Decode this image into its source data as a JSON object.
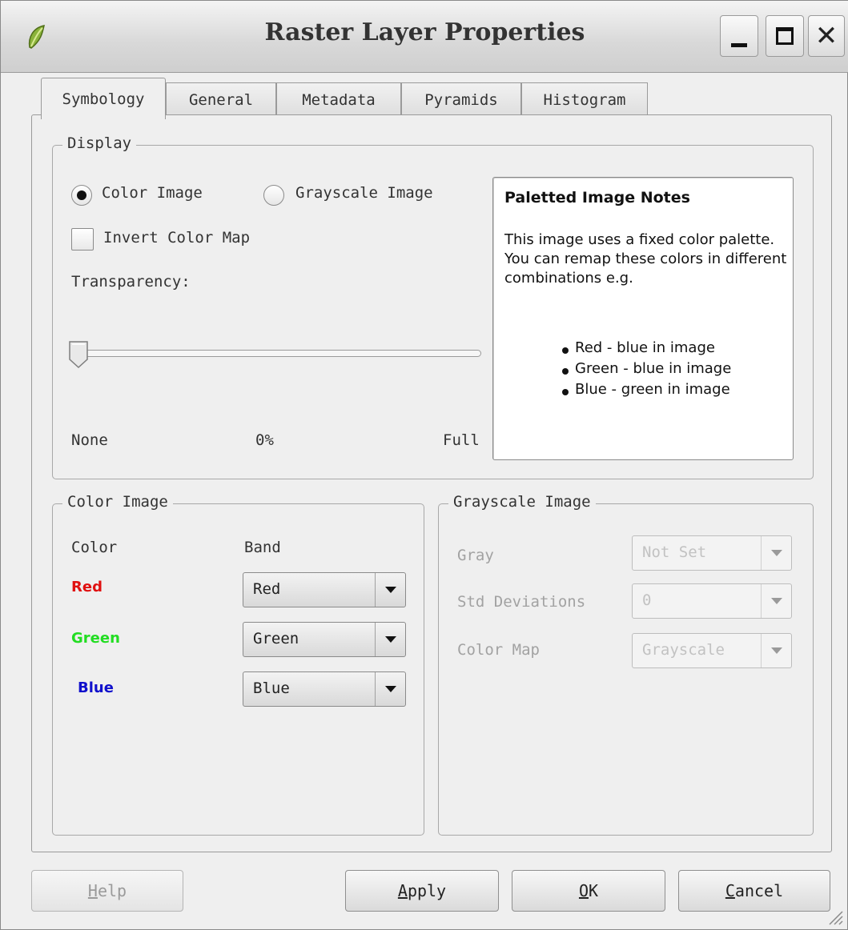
{
  "window": {
    "title": "Raster Layer Properties"
  },
  "tabs": [
    {
      "label": "Symbology",
      "active": true
    },
    {
      "label": "General",
      "active": false
    },
    {
      "label": "Metadata",
      "active": false
    },
    {
      "label": "Pyramids",
      "active": false
    },
    {
      "label": "Histogram",
      "active": false
    }
  ],
  "display": {
    "group_title": "Display",
    "color_image_radio": {
      "label": "Color Image",
      "checked": true
    },
    "grayscale_image_radio": {
      "label": "Grayscale Image",
      "checked": false
    },
    "invert_color_map": {
      "label": "Invert Color Map",
      "checked": false
    },
    "transparency": {
      "label": "Transparency:",
      "min_label": "None",
      "value_label": "0%",
      "max_label": "Full",
      "value_percent": 0
    },
    "notes": {
      "title": "Paletted Image Notes",
      "body": "This image uses a fixed color palette. You can remap these colors in different combinations e.g.",
      "items": [
        "Red - blue in image",
        "Green - blue in image",
        "Blue - green in image"
      ]
    }
  },
  "color_image": {
    "group_title": "Color Image",
    "header_color": "Color",
    "header_band": "Band",
    "rows": [
      {
        "label": "Red",
        "band": "Red",
        "color": "#e01010"
      },
      {
        "label": "Green",
        "band": "Green",
        "color": "#22dd22"
      },
      {
        "label": "Blue",
        "band": "Blue",
        "color": "#1010cc"
      }
    ]
  },
  "grayscale_image": {
    "group_title": "Grayscale Image",
    "gray_label": "Gray",
    "gray_value": "Not Set",
    "std_dev_label": "Std Deviations",
    "std_dev_value": "0",
    "color_map_label": "Color Map",
    "color_map_value": "Grayscale"
  },
  "buttons": {
    "help": {
      "prefix": "",
      "mnemonic": "H",
      "rest": "elp",
      "enabled": false
    },
    "apply": {
      "prefix": "",
      "mnemonic": "A",
      "rest": "pply"
    },
    "ok": {
      "prefix": "",
      "mnemonic": "O",
      "rest": "K"
    },
    "cancel": {
      "prefix": "",
      "mnemonic": "C",
      "rest": "ancel"
    }
  },
  "colors": {
    "window_bg": "#efefef",
    "accent_red": "#e01010",
    "accent_green": "#22dd22",
    "accent_blue": "#1010cc"
  }
}
